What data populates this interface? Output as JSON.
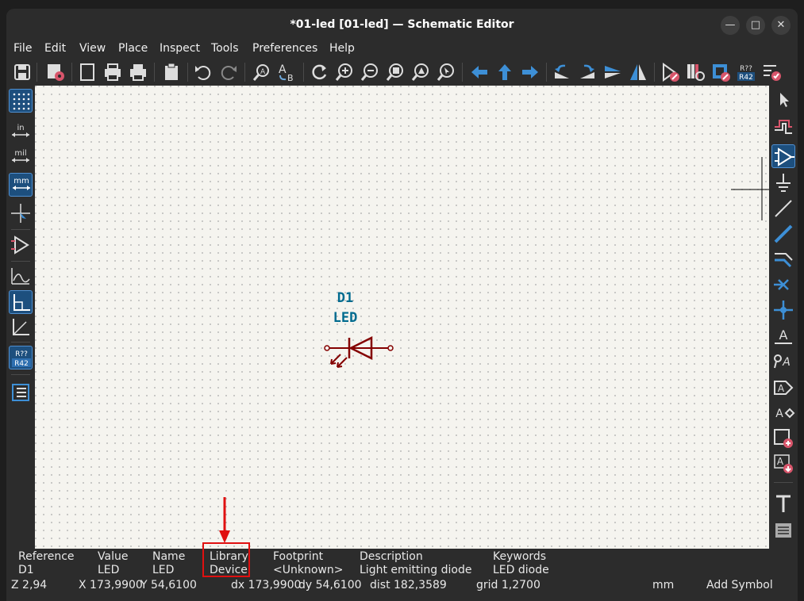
{
  "window": {
    "title": "*01-led [01-led] — Schematic Editor"
  },
  "menu": [
    "File",
    "Edit",
    "View",
    "Place",
    "Inspect",
    "Tools",
    "Preferences",
    "Help"
  ],
  "toolbar_icons": [
    "save-icon",
    "schematic-setup-icon",
    "page-settings-icon",
    "print-icon",
    "plot-icon",
    "paste-icon",
    "undo-icon",
    "redo-icon",
    "find-icon",
    "find-replace-icon",
    "refresh-icon",
    "zoom-in-icon",
    "zoom-out-icon",
    "zoom-fit-icon",
    "zoom-objects-icon",
    "zoom-selection-icon",
    "navigate-back-icon",
    "navigate-up-icon",
    "navigate-forward-icon",
    "rotate-ccw-icon",
    "rotate-cw-icon",
    "mirror-vertical-icon",
    "mirror-horizontal-icon",
    "symbol-editor-icon",
    "symbol-library-browser-icon",
    "footprint-editor-icon",
    "annotate-icon",
    "erc-icon"
  ],
  "left_toolbar_icons": [
    "grid-icon",
    "units-inch-icon",
    "units-mil-icon",
    "units-mm-icon",
    "cursor-crosshair-icon",
    "hidden-pins-icon",
    "wire-posture-icon",
    "line-mode-free-icon",
    "line-mode-90-icon",
    "line-mode-45-icon",
    "annotate-indicator-icon",
    "properties-panel-icon"
  ],
  "right_toolbar_icons": [
    "select-icon",
    "highlight-net-icon",
    "add-symbol-icon",
    "add-power-icon",
    "add-line-icon",
    "add-wire-icon",
    "add-bus-entry-icon",
    "no-connect-icon",
    "junction-icon",
    "net-label-icon",
    "global-label-icon",
    "hierarchical-label-icon",
    "hierarchical-sheet-icon",
    "import-sheet-pin-icon",
    "sheet-pin-icon",
    "text-icon",
    "text-box-icon"
  ],
  "units_labels": {
    "in": "in",
    "mil": "mil",
    "mm": "mm"
  },
  "annotate_badge": {
    "top": "R??",
    "bottom": "R42"
  },
  "schematic": {
    "reference": "D1",
    "value": "LED",
    "text_color": "#006b8f",
    "body_color": "#840000"
  },
  "symbol_info": [
    {
      "header": "Reference",
      "value": "D1"
    },
    {
      "header": "Value",
      "value": "LED"
    },
    {
      "header": "Name",
      "value": "LED"
    },
    {
      "header": "Library",
      "value": "Device"
    },
    {
      "header": "Footprint",
      "value": "<Unknown>"
    },
    {
      "header": "Description",
      "value": "Light emitting diode"
    },
    {
      "header": "Keywords",
      "value": "LED diode"
    }
  ],
  "status": {
    "zoom": "Z 2,94",
    "x": "X 173,9900",
    "y": "Y 54,6100",
    "dx": "dx 173,9900",
    "dy": "dy 54,6100",
    "dist": "dist 182,3589",
    "grid": "grid 1,2700",
    "units": "mm",
    "mode": "Add Symbol"
  },
  "colors": {
    "accent": "#3d8fd6",
    "highlight": "#e01010",
    "background": "#2c2c2c",
    "canvas": "#f5f4ef"
  }
}
